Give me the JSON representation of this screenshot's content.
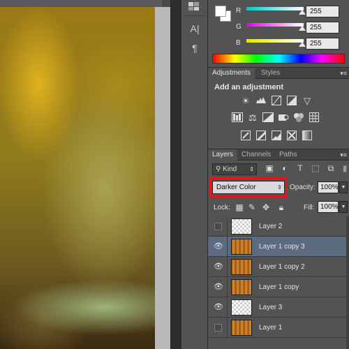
{
  "color_panel": {
    "foreground": "#ffffff",
    "background": "#ffffff",
    "channels": [
      {
        "label": "R",
        "value": "255",
        "gradient": [
          "#00c8c8",
          "#ffffff"
        ]
      },
      {
        "label": "G",
        "value": "255",
        "gradient": [
          "#e600e6",
          "#ffffff"
        ]
      },
      {
        "label": "B",
        "value": "255",
        "gradient": [
          "#e6e600",
          "#ffffff"
        ]
      }
    ]
  },
  "adjustments_panel": {
    "tabs": [
      {
        "label": "Adjustments"
      },
      {
        "label": "Styles"
      }
    ],
    "title": "Add an adjustment",
    "icons": [
      [
        "brightness-contrast-icon",
        "levels-icon",
        "curves-icon",
        "exposure-icon",
        "vibrance-icon"
      ],
      [
        "hue-saturation-icon",
        "color-balance-icon",
        "black-white-icon",
        "photo-filter-icon",
        "channel-mixer-icon",
        "color-lookup-icon"
      ],
      [
        "invert-icon",
        "posterize-icon",
        "threshold-icon",
        "selective-color-icon",
        "gradient-map-icon"
      ]
    ]
  },
  "layers_panel": {
    "tabs": [
      {
        "label": "Layers"
      },
      {
        "label": "Channels"
      },
      {
        "label": "Paths"
      }
    ],
    "filter_label": "Kind",
    "blend_mode": "Darker Color",
    "opacity_label": "Opacity:",
    "opacity_value": "100%",
    "lock_label": "Lock:",
    "fill_label": "Fill:",
    "fill_value": "100%",
    "layers": [
      {
        "name": "Layer 2",
        "visible": false,
        "thumbnail": "transparent",
        "selected": false
      },
      {
        "name": "Layer 1 copy 3",
        "visible": true,
        "thumbnail": "photo",
        "selected": true
      },
      {
        "name": "Layer 1 copy 2",
        "visible": true,
        "thumbnail": "photo",
        "selected": false
      },
      {
        "name": "Layer 1 copy",
        "visible": true,
        "thumbnail": "photo",
        "selected": false
      },
      {
        "name": "Layer 3",
        "visible": true,
        "thumbnail": "transparent",
        "selected": false
      },
      {
        "name": "Layer 1",
        "visible": false,
        "thumbnail": "photo",
        "selected": false
      }
    ]
  },
  "tool_strip": {
    "icons": [
      "color-panel-icon",
      "character-panel-icon",
      "paragraph-panel-icon"
    ]
  }
}
